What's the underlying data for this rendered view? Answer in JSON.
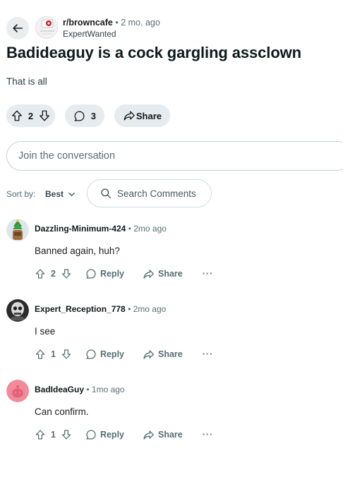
{
  "post": {
    "subreddit": "r/browncafe",
    "age": "2 mo. ago",
    "username": "ExpertWanted",
    "title": "Badideaguy is a cock gargling assclown",
    "body": "That is all",
    "votes": "2",
    "comments_count": "3",
    "share_label": "Share"
  },
  "composer": {
    "placeholder": "Join the conversation"
  },
  "sort": {
    "label": "Sort by:",
    "value": "Best",
    "search_label": "Search Comments"
  },
  "comments": [
    {
      "author": "Dazzling-Minimum-424",
      "age": "2mo ago",
      "text": "Banned again, huh?",
      "votes": "2",
      "reply": "Reply",
      "share": "Share"
    },
    {
      "author": "Expert_Reception_778",
      "age": "2mo ago",
      "text": "I see",
      "votes": "1",
      "reply": "Reply",
      "share": "Share"
    },
    {
      "author": "BadIdeaGuy",
      "age": "1mo ago",
      "text": "Can confirm.",
      "votes": "1",
      "reply": "Reply",
      "share": "Share"
    }
  ],
  "icons": [
    "back-arrow-icon",
    "upvote-icon",
    "downvote-icon",
    "comment-icon",
    "share-icon",
    "search-icon",
    "chevron-down-icon",
    "more-icon"
  ],
  "colors": {
    "pill_bg": "#e5ebee",
    "meta_text": "#576f76",
    "avatar_pink": "#f08b9a"
  }
}
